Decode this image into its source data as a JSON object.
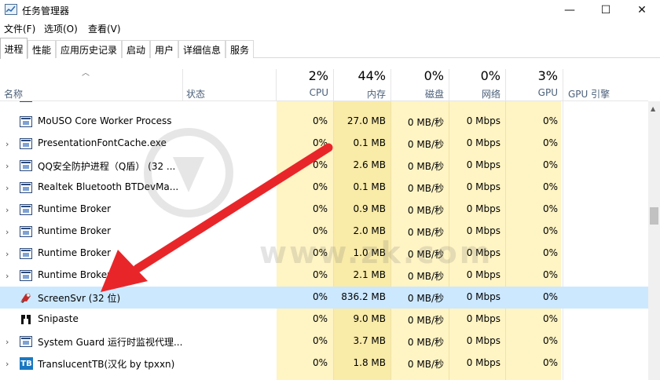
{
  "window": {
    "title": "任务管理器",
    "minimize_glyph": "—",
    "maximize_glyph": "☐",
    "close_glyph": "✕"
  },
  "menu": [
    "文件(F)",
    "选项(O)",
    "查看(V)"
  ],
  "tabs": [
    "进程",
    "性能",
    "应用历史记录",
    "启动",
    "用户",
    "详细信息",
    "服务"
  ],
  "header": {
    "name": "名称",
    "status": "状态",
    "cpu_pct": "2%",
    "cpu": "CPU",
    "mem_pct": "44%",
    "mem": "内存",
    "disk_pct": "0%",
    "disk": "磁盘",
    "net_pct": "0%",
    "net": "网络",
    "gpu_pct": "3%",
    "gpu": "GPU",
    "gpu_engine": "GPU 引擎"
  },
  "processes": [
    {
      "name": "MoUSO Core Worker Process",
      "cpu": "0%",
      "mem": "27.0 MB",
      "disk": "0 MB/秒",
      "net": "0 Mbps",
      "gpu": "0%",
      "expandable": false,
      "icon": "window-app-icon"
    },
    {
      "name": "PresentationFontCache.exe",
      "cpu": "0%",
      "mem": "0.1 MB",
      "disk": "0 MB/秒",
      "net": "0 Mbps",
      "gpu": "0%",
      "expandable": true,
      "icon": "window-app-icon"
    },
    {
      "name": "QQ安全防护进程（Q盾） (32 ...",
      "cpu": "0%",
      "mem": "2.6 MB",
      "disk": "0 MB/秒",
      "net": "0 Mbps",
      "gpu": "0%",
      "expandable": true,
      "icon": "window-app-icon"
    },
    {
      "name": "Realtek Bluetooth BTDevMa...",
      "cpu": "0%",
      "mem": "0.1 MB",
      "disk": "0 MB/秒",
      "net": "0 Mbps",
      "gpu": "0%",
      "expandable": true,
      "icon": "window-app-icon"
    },
    {
      "name": "Runtime Broker",
      "cpu": "0%",
      "mem": "0.9 MB",
      "disk": "0 MB/秒",
      "net": "0 Mbps",
      "gpu": "0%",
      "expandable": true,
      "icon": "window-app-icon"
    },
    {
      "name": "Runtime Broker",
      "cpu": "0%",
      "mem": "2.0 MB",
      "disk": "0 MB/秒",
      "net": "0 Mbps",
      "gpu": "0%",
      "expandable": true,
      "icon": "window-app-icon"
    },
    {
      "name": "Runtime Broker",
      "cpu": "0%",
      "mem": "1.0 MB",
      "disk": "0 MB/秒",
      "net": "0 Mbps",
      "gpu": "0%",
      "expandable": true,
      "icon": "window-app-icon"
    },
    {
      "name": "Runtime Broker",
      "cpu": "0%",
      "mem": "2.1 MB",
      "disk": "0 MB/秒",
      "net": "0 Mbps",
      "gpu": "0%",
      "expandable": true,
      "icon": "window-app-icon"
    },
    {
      "name": "ScreenSvr (32 位)",
      "cpu": "0%",
      "mem": "836.2 MB",
      "disk": "0 MB/秒",
      "net": "0 Mbps",
      "gpu": "0%",
      "expandable": false,
      "icon": "screensvr-icon",
      "selected": true
    },
    {
      "name": "Snipaste",
      "cpu": "0%",
      "mem": "9.0 MB",
      "disk": "0 MB/秒",
      "net": "0 Mbps",
      "gpu": "0%",
      "expandable": false,
      "icon": "snipaste-icon"
    },
    {
      "name": "System Guard 运行时监视代理...",
      "cpu": "0%",
      "mem": "3.7 MB",
      "disk": "0 MB/秒",
      "net": "0 Mbps",
      "gpu": "0%",
      "expandable": true,
      "icon": "window-app-icon"
    },
    {
      "name": "TranslucentTB(汉化 by tpxxn)",
      "cpu": "0%",
      "mem": "1.8 MB",
      "disk": "0 MB/秒",
      "net": "0 Mbps",
      "gpu": "0%",
      "expandable": true,
      "icon": "translucenttb-icon"
    }
  ],
  "watermark": {
    "url": "www.zk.com"
  },
  "colors": {
    "accent_arrow": "#e8262a",
    "selected_row": "#cce8ff",
    "usage_yellow": "#fff4c4",
    "usage_yellow_mem": "#f9eba8",
    "header_label": "#4c607a"
  }
}
